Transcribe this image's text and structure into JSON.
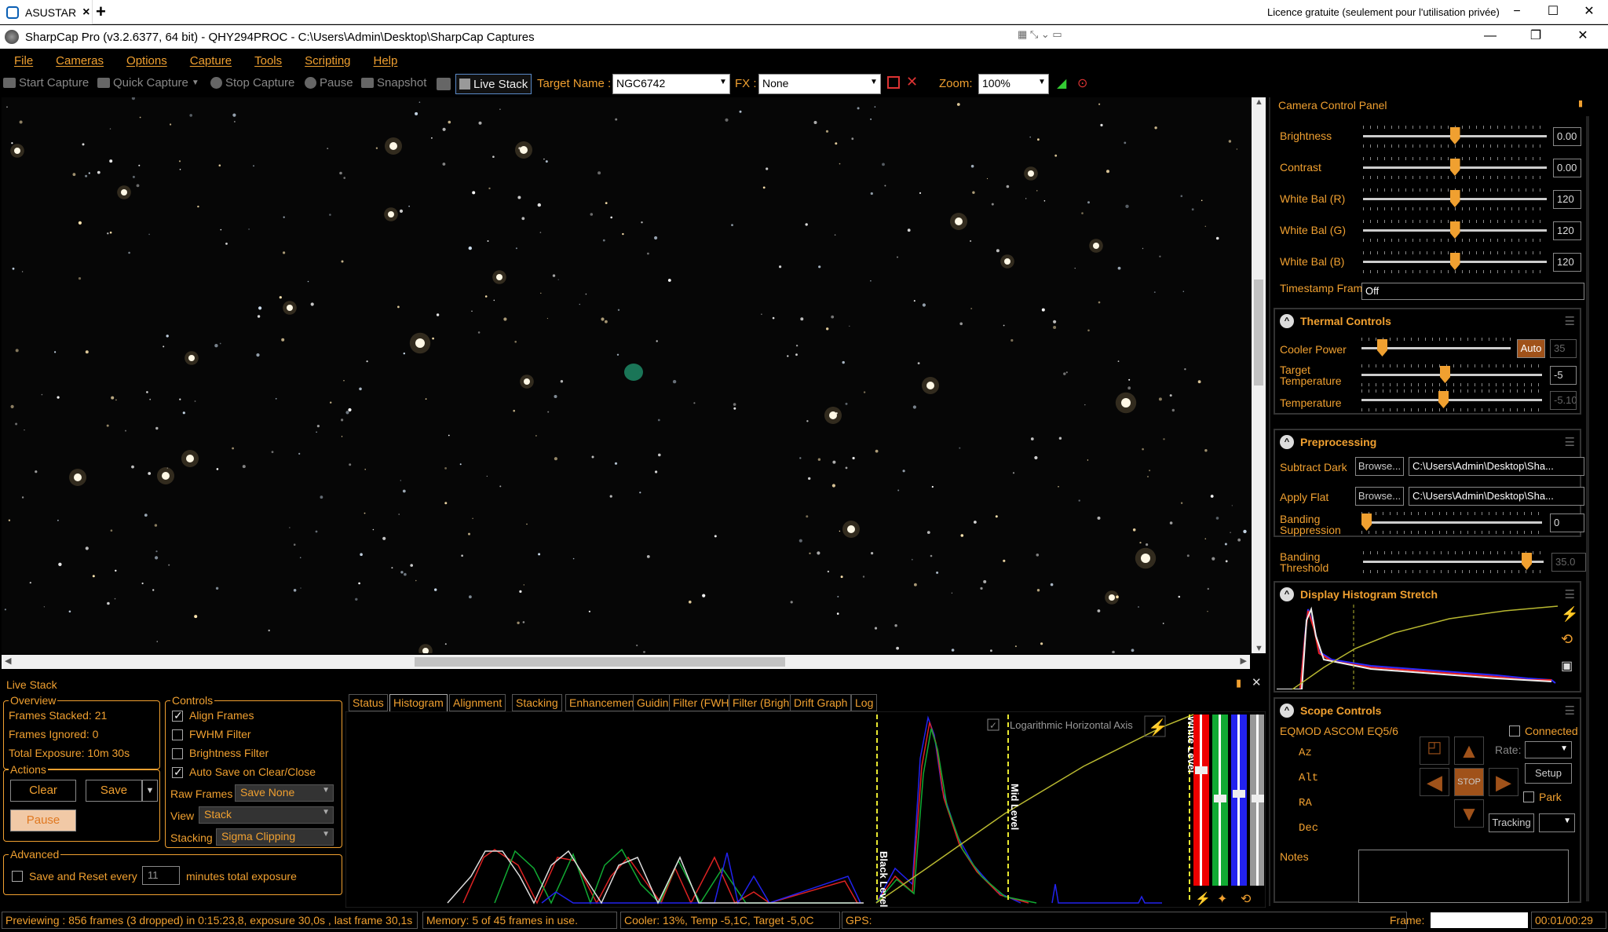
{
  "remote": {
    "tab_label": "ASUSTAR",
    "tab_close": "×",
    "new_tab": "+",
    "licence": "Licence gratuite (seulement pour l'utilisation privée)",
    "minimize": "−",
    "maximize": "☐",
    "close": "✕"
  },
  "window": {
    "title": "SharpCap Pro (v3.2.6377, 64 bit) - QHY294PROC - C:\\Users\\Admin\\Desktop\\SharpCap Captures",
    "minimize": "—",
    "restore": "❐",
    "close": "✕"
  },
  "menu": [
    "File",
    "Cameras",
    "Options",
    "Capture",
    "Tools",
    "Scripting",
    "Help"
  ],
  "toolbar": {
    "start_capture": "Start Capture",
    "quick_capture": "Quick Capture",
    "stop_capture": "Stop Capture",
    "pause": "Pause",
    "snapshot": "Snapshot",
    "live_stack": "Live Stack",
    "target_label": "Target Name :",
    "target_value": "NGC6742",
    "fx_label": "FX :",
    "fx_value": "None",
    "zoom_label": "Zoom:",
    "zoom_value": "100%"
  },
  "panel": {
    "title": "Camera Control Panel",
    "pin": "📌",
    "image_controls": [
      {
        "label": "Brightness",
        "value": "0.00",
        "level": 0.5
      },
      {
        "label": "Contrast",
        "value": "0.00",
        "level": 0.5
      },
      {
        "label": "White Bal (R)",
        "value": "120",
        "level": 0.5
      },
      {
        "label": "White Bal (G)",
        "value": "120",
        "level": 0.5
      },
      {
        "label": "White Bal (B)",
        "value": "120",
        "level": 0.5
      }
    ],
    "timestamp_label": "Timestamp Frames",
    "timestamp_value": "Off",
    "thermal": {
      "title": "Thermal Controls",
      "cooler_label": "Cooler Power",
      "cooler_auto": "Auto",
      "cooler_value": "35",
      "target_label": "Target Temperature",
      "target_value": "-5",
      "temp_label": "Temperature",
      "temp_value": "-5.10"
    },
    "preprocessing": {
      "title": "Preprocessing",
      "dark_label": "Subtract Dark",
      "flat_label": "Apply Flat",
      "browse": "Browse...",
      "dark_path": "C:\\Users\\Admin\\Desktop\\Sha...",
      "flat_path": "C:\\Users\\Admin\\Desktop\\Sha...",
      "banding_label": "Banding Suppression",
      "banding_value": "0",
      "threshold_label": "Banding Threshold",
      "threshold_value": "35.0"
    },
    "histogram": {
      "title": "Display Histogram Stretch"
    },
    "scope": {
      "title": "Scope Controls",
      "mount": "EQMOD ASCOM EQ5/6",
      "connected": "Connected",
      "axes": [
        "Az",
        "Alt",
        "RA",
        "Dec"
      ],
      "rate": "Rate:",
      "setup": "Setup",
      "park": "Park",
      "stop": "STOP",
      "tracking": "Tracking"
    },
    "notes": "Notes"
  },
  "live_stack": {
    "title": "Live Stack",
    "overview": {
      "title": "Overview",
      "frames_stacked": "Frames Stacked:  21",
      "frames_ignored": "Frames Ignored:   0",
      "total_exposure": "Total Exposure:   10m 30s"
    },
    "actions": {
      "title": "Actions",
      "clear": "Clear",
      "save": "Save",
      "pause": "Pause"
    },
    "advanced": {
      "title": "Advanced",
      "save_reset": "Save and Reset every",
      "minutes_value": "11",
      "minutes_label": "minutes total exposure"
    },
    "controls": {
      "title": "Controls",
      "align": "Align Frames",
      "fwhm": "FWHM Filter",
      "brightness": "Brightness Filter",
      "autosave": "Auto Save on Clear/Close",
      "raw_label": "Raw Frames",
      "raw_value": "Save None",
      "view_label": "View",
      "view_value": "Stack",
      "stacking_label": "Stacking",
      "stacking_value": "Sigma Clipping"
    },
    "tabs": [
      "Status",
      "Histogram",
      "Alignment",
      "Stacking",
      "Enhancement",
      "Guiding",
      "Filter (FWHM)",
      "Filter (Brightness)",
      "Drift Graph",
      "Log"
    ],
    "histogram": {
      "log_axis": "Logarithmic Horizontal Axis",
      "black_level": "Black Level",
      "mid_level": "Mid Level",
      "white_level": "White Level"
    }
  },
  "status": {
    "previewing": "Previewing : 856 frames (3 dropped) in 0:15:23,8, exposure 30,0s , last frame 30,1s",
    "memory": "Memory: 5 of 45 frames in use.",
    "cooler": "Cooler: 13%, Temp -5,1C, Target -5,0C",
    "gps": "GPS:",
    "frame_label": "Frame:",
    "frame_time": "00:01/00:29"
  },
  "colors": {
    "accent": "#f0a030",
    "background": "#000000"
  }
}
